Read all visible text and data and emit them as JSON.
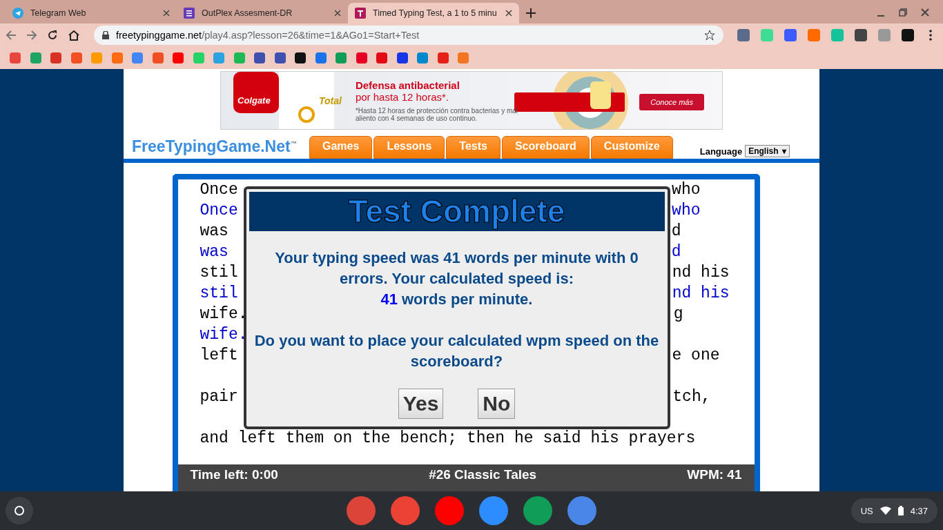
{
  "tabs": [
    {
      "title": "Telegram Web",
      "selected": false
    },
    {
      "title": "OutPlex Assesment-DR",
      "selected": false
    },
    {
      "title": "Timed Typing Test, a 1 to 5 minu",
      "selected": true
    }
  ],
  "address_bar": {
    "domain": "freetypinggame.net",
    "path": "/play4.asp?lesson=26&time=1&AGo1=Start+Test"
  },
  "ad": {
    "brand": "Colgate",
    "product": "Total",
    "headline": "Defensa antibacterial",
    "subline": "por hasta 12 horas*.",
    "fineprint": "*Hasta 12 horas de protección contra bacterias y mal aliento con 4 semanas de uso continuo.",
    "cta": "Conoce más"
  },
  "site": {
    "logo": "FreeTypingGame.Net",
    "trademark": "™",
    "nav": [
      "Games",
      "Lessons",
      "Tests",
      "Scoreboard",
      "Customize"
    ],
    "language_label": "Language",
    "language": "English",
    "language_arrow": "▾"
  },
  "lines": [
    {
      "kind": "text",
      "left": "Once",
      "right": "who",
      "typed": false
    },
    {
      "kind": "text",
      "left": "Once",
      "right": "who",
      "typed": true
    },
    {
      "kind": "text",
      "left": "was",
      "right": "d",
      "typed": false
    },
    {
      "kind": "text",
      "left": "was",
      "right": "d",
      "typed": true
    },
    {
      "kind": "text",
      "left": "stil",
      "right": "nd his",
      "typed": false
    },
    {
      "kind": "text",
      "left": "stil",
      "right": "nd his",
      "typed": true
    },
    {
      "kind": "text",
      "left": "wife.",
      "right": "g",
      "typed": false
    },
    {
      "kind": "text",
      "left": "wife.",
      "typed": true
    },
    {
      "kind": "text",
      "left": "left",
      "right": "e one",
      "typed": false
    },
    {
      "kind": "blank"
    },
    {
      "kind": "text",
      "left": "pair",
      "right": "tch,",
      "typed": false
    },
    {
      "kind": "blank"
    },
    {
      "kind": "text",
      "left": "and left them on the bench; then he said his prayers",
      "typed": false
    }
  ],
  "dialog": {
    "title": "Test Complete",
    "message": "Your typing speed was 41 words per minute with 0 errors. Your calculated speed is:",
    "speed": "41",
    "speed_unit": "words per minute.",
    "question": "Do you want to place your calculated wpm speed on the scoreboard?",
    "buttons": [
      "Yes",
      "No"
    ]
  },
  "status_bar": {
    "time_left": "Time left: 0:00",
    "lesson": "#26 Classic Tales",
    "wpm": "WPM: 41"
  },
  "shelf": {
    "locale": "US",
    "time": "4:37"
  }
}
